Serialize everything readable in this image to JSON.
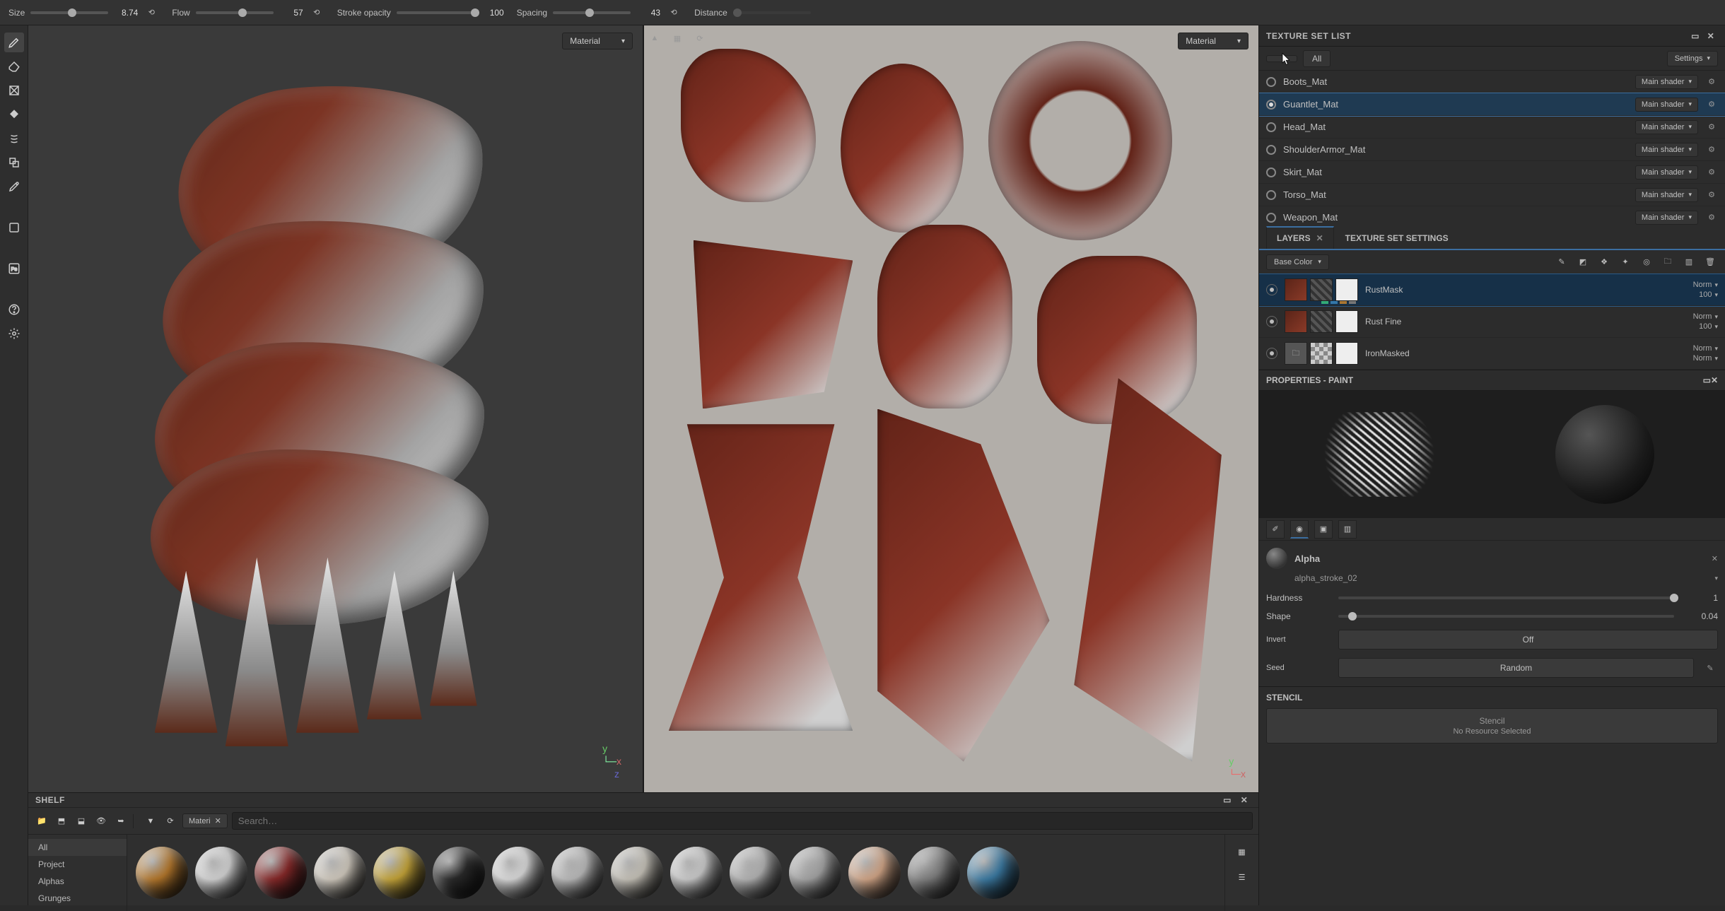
{
  "topbar": {
    "size_label": "Size",
    "size_value": "8.74",
    "flow_label": "Flow",
    "flow_value": "57",
    "opacity_label": "Stroke opacity",
    "opacity_value": "100",
    "spacing_label": "Spacing",
    "spacing_value": "43",
    "distance_label": "Distance"
  },
  "viewport": {
    "material_label": "Material",
    "axis_y": "y",
    "axis_x": "x",
    "axis_z": "z"
  },
  "texture_set": {
    "title": "TEXTURE SET LIST",
    "all_label": "All",
    "settings_label": "Settings",
    "shader_label": "Main shader",
    "items": [
      {
        "name": "Boots_Mat",
        "selected": false
      },
      {
        "name": "Guantlet_Mat",
        "selected": true
      },
      {
        "name": "Head_Mat",
        "selected": false
      },
      {
        "name": "ShoulderArmor_Mat",
        "selected": false
      },
      {
        "name": "Skirt_Mat",
        "selected": false
      },
      {
        "name": "Torso_Mat",
        "selected": false
      },
      {
        "name": "Weapon_Mat",
        "selected": false
      }
    ]
  },
  "layers": {
    "tab_layers": "LAYERS",
    "tab_settings": "TEXTURE SET SETTINGS",
    "channel": "Base Color",
    "blend_label": "Norm",
    "rows": [
      {
        "name": "RustMask",
        "opacity": "100",
        "selected": true
      },
      {
        "name": "Rust Fine",
        "opacity": "100",
        "selected": false
      },
      {
        "name": "IronMasked",
        "opacity": "",
        "selected": false,
        "folder": true
      }
    ]
  },
  "properties": {
    "title": "PROPERTIES - PAINT",
    "alpha_title": "Alpha",
    "alpha_name": "alpha_stroke_02",
    "hardness_label": "Hardness",
    "hardness_value": "1",
    "shape_label": "Shape",
    "shape_value": "0.04",
    "invert_label": "Invert",
    "invert_value": "Off",
    "seed_label": "Seed",
    "seed_value": "Random",
    "stencil_title": "STENCIL",
    "stencil_box": "Stencil",
    "stencil_none": "No Resource Selected"
  },
  "shelf": {
    "title": "SHELF",
    "search_placeholder": "Search…",
    "tag": "Materi",
    "cats": [
      "All",
      "Project",
      "Alphas",
      "Grunges"
    ],
    "materials": [
      "#b87a2d",
      "#d9d9d9",
      "#8a2a2a",
      "#d6cfc3",
      "#c9a83a",
      "#2b2b2b",
      "#e0e0e0",
      "#bfbfbf",
      "#cbc7bd",
      "#d0d0d0",
      "#b8b8b8",
      "#a8a8a8",
      "#d6a98a",
      "#828282",
      "#3d7da6"
    ]
  }
}
